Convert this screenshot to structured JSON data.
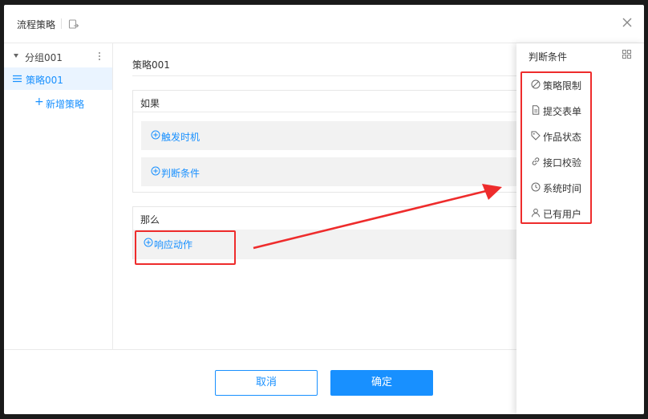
{
  "dialog": {
    "title": "流程策略",
    "close_icon": "close-icon",
    "export_icon": "export-icon"
  },
  "tree": {
    "group_label": "分组001",
    "strategy_label": "策略001",
    "add_strategy_label": "新增策略"
  },
  "main": {
    "strategy_name": "策略001",
    "if_title": "如果",
    "if_rows": [
      {
        "label": "触发时机",
        "icon": "plus-circle-icon"
      },
      {
        "label": "判断条件",
        "icon": "plus-circle-icon"
      }
    ],
    "then_title": "那么",
    "then_row": {
      "label": "响应动作",
      "icon": "plus-circle-icon"
    }
  },
  "panel": {
    "title": "判断条件",
    "items": [
      {
        "label": "策略限制",
        "icon": "ban-icon"
      },
      {
        "label": "提交表单",
        "icon": "form-icon"
      },
      {
        "label": "作品状态",
        "icon": "tag-icon"
      },
      {
        "label": "接口校验",
        "icon": "link-icon"
      },
      {
        "label": "系统时间",
        "icon": "clock-icon"
      },
      {
        "label": "已有用户",
        "icon": "user-icon"
      }
    ]
  },
  "footer": {
    "cancel_label": "取消",
    "ok_label": "确定"
  },
  "colors": {
    "accent": "#1890ff",
    "annotation_red": "#ee2c2c",
    "row_bg": "#f2f2f2",
    "selected_bg": "#eaf4ff"
  }
}
